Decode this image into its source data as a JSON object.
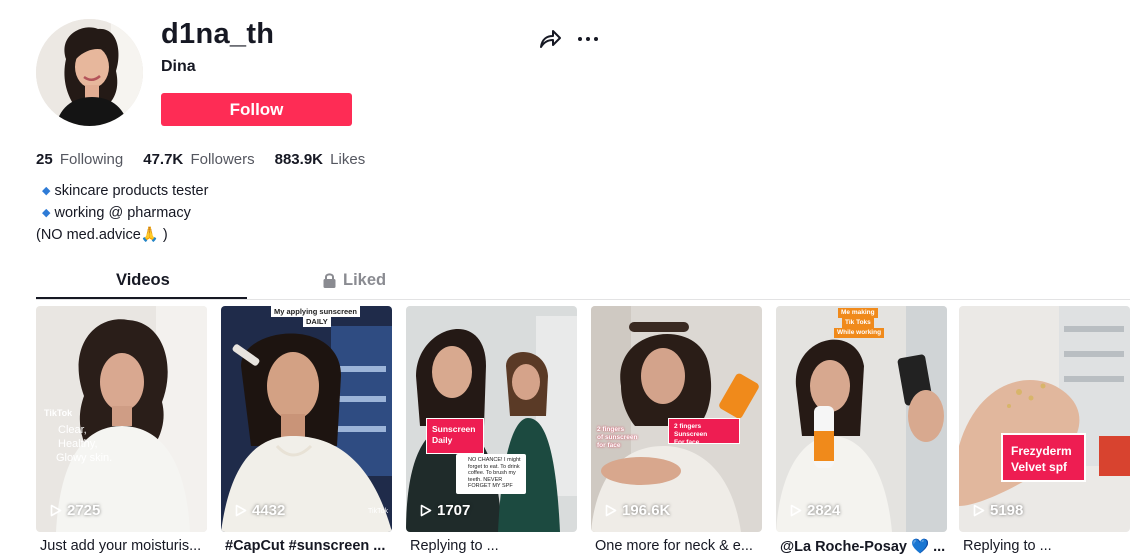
{
  "profile": {
    "username": "d1na_th",
    "display_name": "Dina",
    "follow_label": "Follow"
  },
  "stats": [
    {
      "value": "25",
      "label": "Following"
    },
    {
      "value": "47.7K",
      "label": "Followers"
    },
    {
      "value": "883.9K",
      "label": "Likes"
    }
  ],
  "bio": {
    "line1": "skincare products tester",
    "line2": "working @ pharmacy",
    "line3": "(NO med.advice🙏 )"
  },
  "tabs": {
    "videos": "Videos",
    "liked": "Liked"
  },
  "videos": [
    {
      "views": "2725",
      "caption": "Just add your moisturis...",
      "overlay": [
        "Clear,",
        "Healthy,",
        "Glowy skin."
      ],
      "watermark": "TikTok"
    },
    {
      "views": "4432",
      "caption": "#CapCut #sunscreen ...",
      "label": [
        "My applying sunscreen",
        "DAILY"
      ],
      "watermark": "TikTok"
    },
    {
      "views": "1707",
      "caption": "Replying to ...",
      "box": [
        "Sunscreen",
        "Daily"
      ],
      "comment": "NO CHANCE! I might forget to eat. To drink coffee. To brush my teeth. NEVER FORGET MY SPF"
    },
    {
      "views": "196.6K",
      "caption": "One more for neck & e...",
      "overlay": [
        "2 fingers",
        "of sunscreen",
        "for face"
      ],
      "box": [
        "2 fingers Sunscreen",
        "For face"
      ]
    },
    {
      "views": "2824",
      "caption": "@La Roche-Posay 💙 ...",
      "tag": [
        "Me making",
        "Tik Toks",
        "While working"
      ]
    },
    {
      "views": "5198",
      "caption": "Replying to ...",
      "box": [
        "Frezyderm",
        "Velvet spf"
      ]
    }
  ],
  "colors": {
    "accent": "#fe2c55",
    "text": "#161823",
    "muted": "#8a8b91"
  }
}
